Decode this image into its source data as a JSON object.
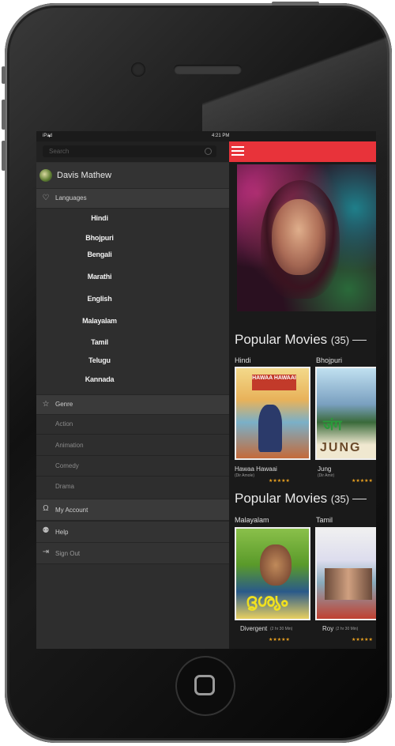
{
  "status": {
    "carrier": "iPad",
    "time": "4:21 PM"
  },
  "drawer": {
    "search_placeholder": "Search",
    "user_name": "Davis Mathew",
    "languages_label": "Languages",
    "languages": [
      "Hindi",
      "Bhojpuri",
      "Bengali",
      "Marathi",
      "English",
      "Malayalam",
      "Tamil",
      "Telugu",
      "Kannada"
    ],
    "genre_label": "Genre",
    "genres": [
      "Action",
      "Animation",
      "Comedy",
      "Drama"
    ],
    "account_label": "My Account",
    "help_label": "Help",
    "signout_label": "Sign Out"
  },
  "main": {
    "sections": [
      {
        "title": "Popular Movies",
        "count": "(35)",
        "columns": [
          {
            "language": "Hindi",
            "movie": "Hawaa Hawaai",
            "sub": "(Dir Amole)",
            "poster_text": "HAWAA HAWAAI"
          },
          {
            "language": "Bhojpuri",
            "movie": "Jung",
            "sub": "(Dir Amir)",
            "poster_text": "JUNG"
          }
        ]
      },
      {
        "title": "Popular Movies",
        "count": "(35)",
        "columns": [
          {
            "language": "Malayalam",
            "movie": "Divergent",
            "sub": "(2 hr 30 Min)",
            "poster_text": ""
          },
          {
            "language": "Tamil",
            "movie": "Roy",
            "sub": "(2 hr 30 Min)",
            "poster_text": ""
          }
        ]
      }
    ],
    "rating_stars": "★★★★★"
  },
  "colors": {
    "accent": "#e8333a",
    "star": "#e8a020"
  }
}
